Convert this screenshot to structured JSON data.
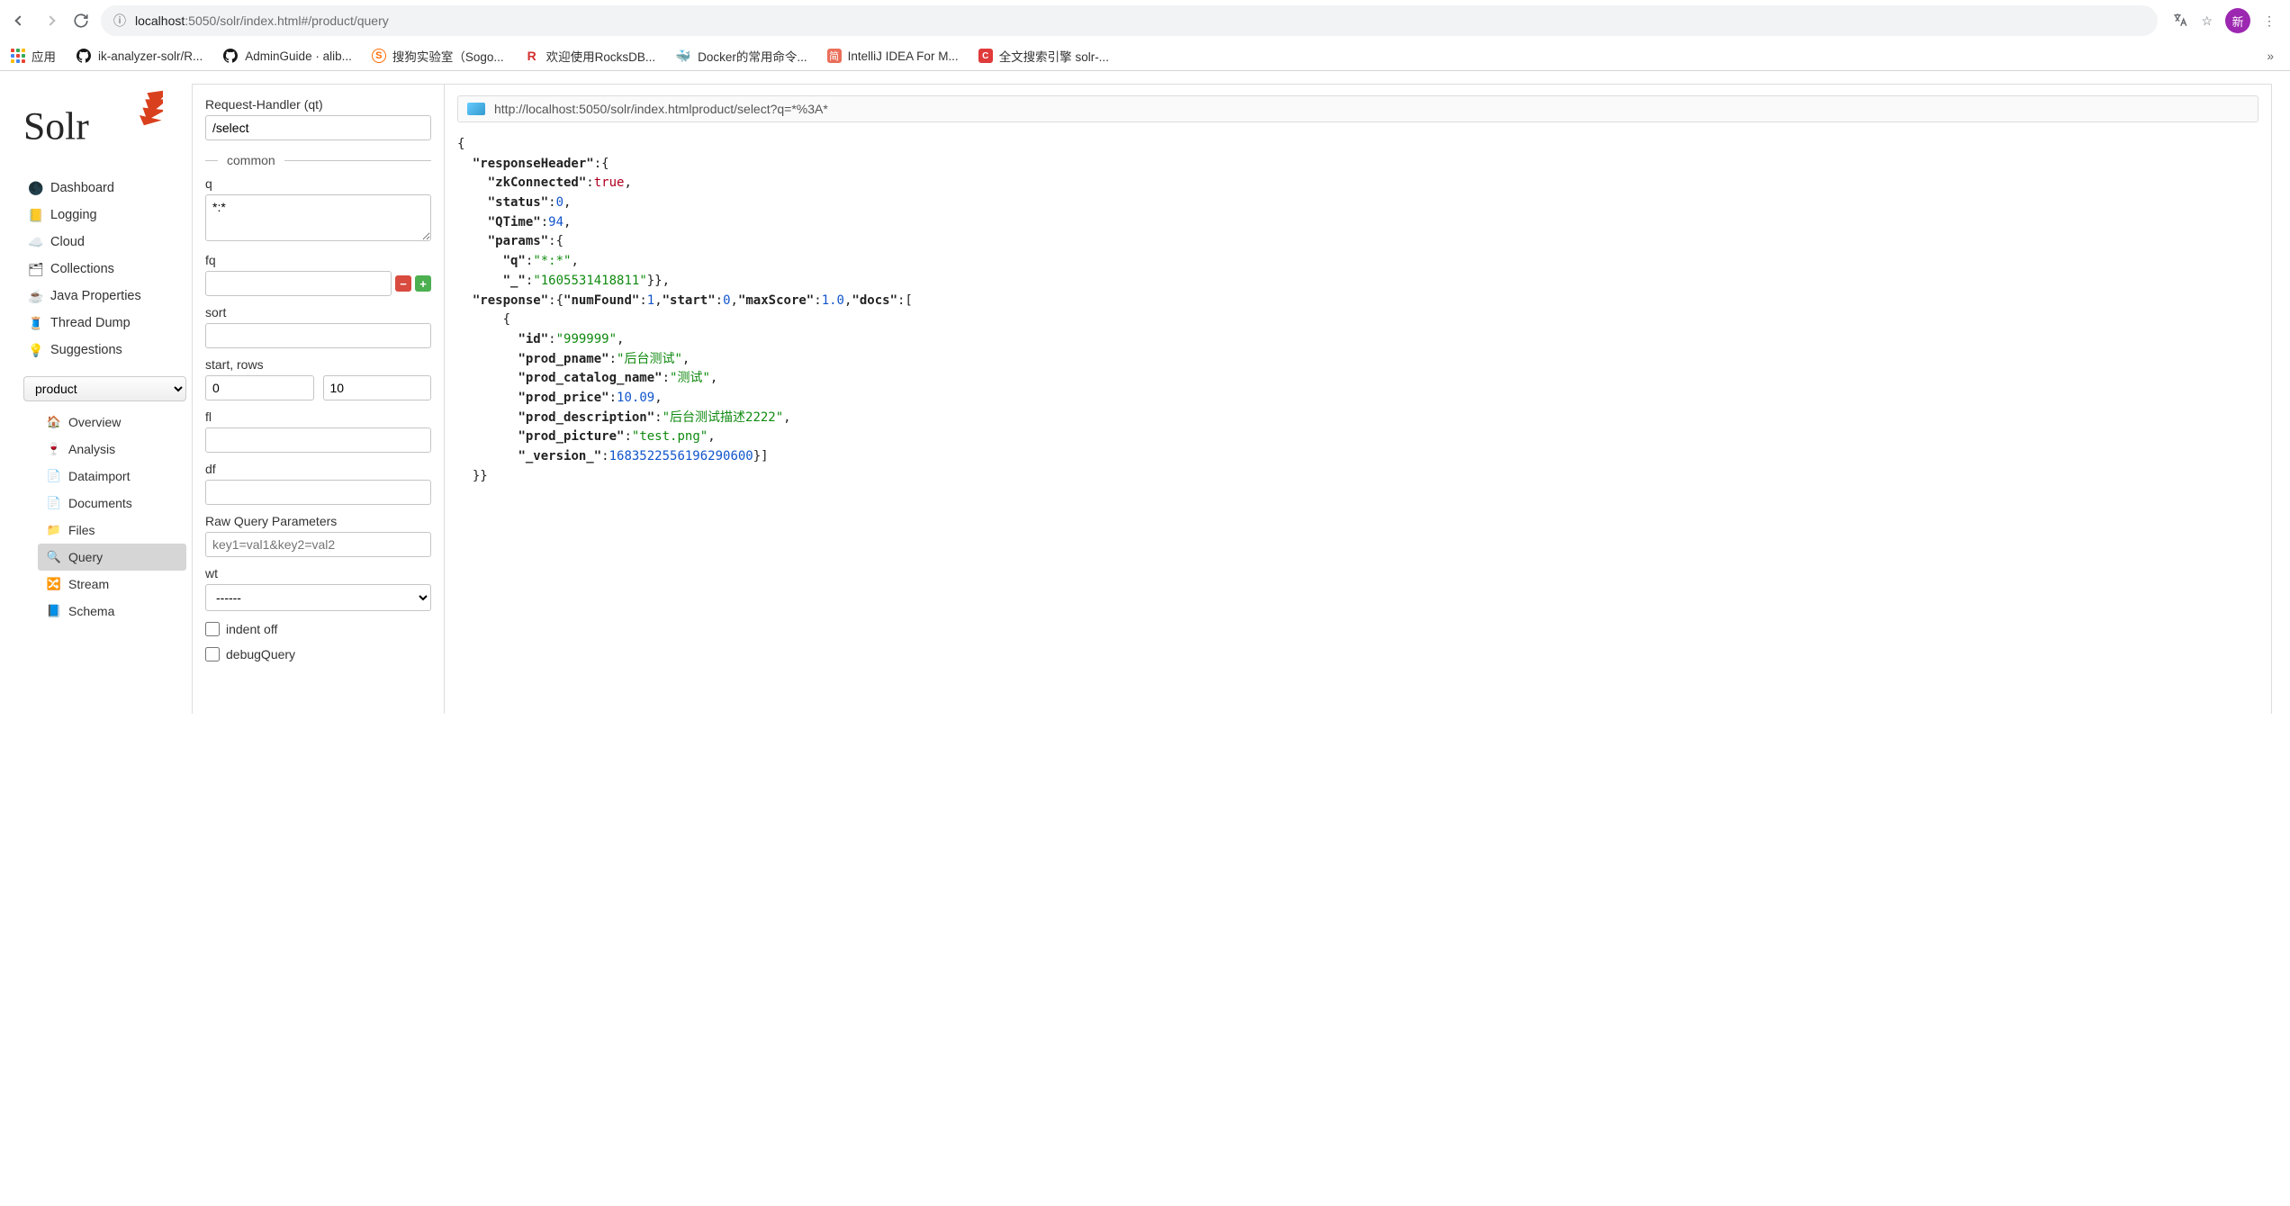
{
  "browser": {
    "url_host": "localhost",
    "url_port": ":5050",
    "url_path": "/solr/index.html#/product/query",
    "avatar_char": "新",
    "bookmarks": [
      {
        "icon": "apps",
        "label": "应用"
      },
      {
        "icon": "github",
        "label": "ik-analyzer-solr/R..."
      },
      {
        "icon": "github",
        "label": "AdminGuide · alib..."
      },
      {
        "icon": "sogou",
        "label": "搜狗实验室（Sogo..."
      },
      {
        "icon": "rocks",
        "label": "欢迎使用RocksDB..."
      },
      {
        "icon": "docker",
        "label": "Docker的常用命令..."
      },
      {
        "icon": "jian",
        "label": "IntelliJ IDEA For M..."
      },
      {
        "icon": "csdn",
        "label": "全文搜索引擎 solr-..."
      }
    ]
  },
  "sidebar": {
    "nav": [
      {
        "icon": "🌑",
        "label": "Dashboard"
      },
      {
        "icon": "📒",
        "label": "Logging"
      },
      {
        "icon": "☁️",
        "label": "Cloud"
      },
      {
        "icon": "🗂",
        "label": "Collections"
      },
      {
        "icon": "☕",
        "label": "Java Properties"
      },
      {
        "icon": "🧵",
        "label": "Thread Dump"
      },
      {
        "icon": "💡",
        "label": "Suggestions"
      }
    ],
    "selected_core": "product",
    "subnav": [
      {
        "icon": "🏠",
        "label": "Overview"
      },
      {
        "icon": "🍷",
        "label": "Analysis"
      },
      {
        "icon": "📄",
        "label": "Dataimport"
      },
      {
        "icon": "📄",
        "label": "Documents"
      },
      {
        "icon": "📁",
        "label": "Files"
      },
      {
        "icon": "🔍",
        "label": "Query",
        "active": true
      },
      {
        "icon": "🔀",
        "label": "Stream"
      },
      {
        "icon": "📘",
        "label": "Schema"
      }
    ]
  },
  "form": {
    "qt_label": "Request-Handler (qt)",
    "qt_value": "/select",
    "common_label": "common",
    "q_label": "q",
    "q_value": "*:*",
    "fq_label": "fq",
    "fq_value": "",
    "sort_label": "sort",
    "sort_value": "",
    "startrows_label": "start, rows",
    "start_value": "0",
    "rows_value": "10",
    "fl_label": "fl",
    "fl_value": "",
    "df_label": "df",
    "df_value": "",
    "raw_label": "Raw Query Parameters",
    "raw_placeholder": "key1=val1&key2=val2",
    "wt_label": "wt",
    "wt_value": "------",
    "indent_label": "indent off",
    "debug_label": "debugQuery"
  },
  "results": {
    "url": "http://localhost:5050/solr/index.htmlproduct/select?q=*%3A*",
    "json": {
      "responseHeader": {
        "zkConnected": true,
        "status": 0,
        "QTime": 94,
        "params": {
          "q": "*:*",
          "_": "1605531418811"
        }
      },
      "response": {
        "numFound": 1,
        "start": 0,
        "maxScore": 1.0,
        "docs": [
          {
            "id": "999999",
            "prod_pname": "后台测试",
            "prod_catalog_name": "测试",
            "prod_price": 10.09,
            "prod_description": "后台测试描述2222",
            "prod_picture": "test.png",
            "_version_": 1683522556196290560
          }
        ]
      }
    }
  }
}
